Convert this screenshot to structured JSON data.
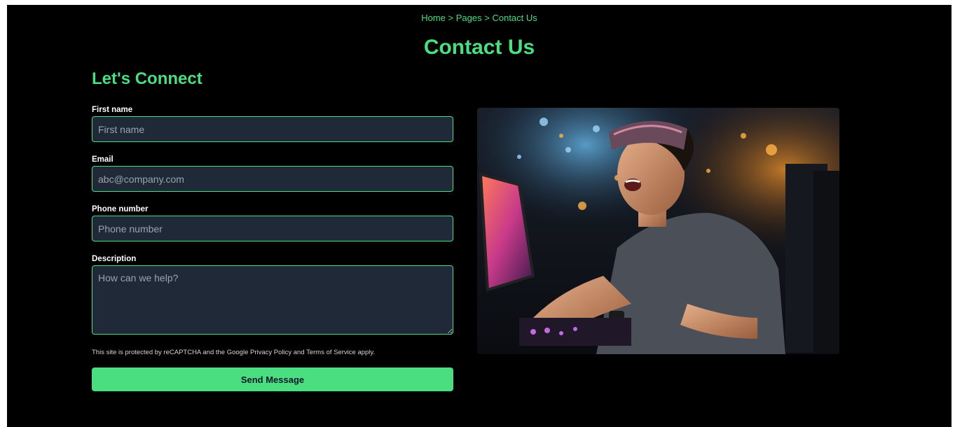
{
  "breadcrumb": {
    "home": "Home",
    "sep1": ">",
    "pages": "Pages",
    "sep2": ">",
    "current": "Contact Us"
  },
  "page_title": "Contact Us",
  "section_title": "Let's Connect",
  "form": {
    "first_name": {
      "label": "First name",
      "placeholder": "First name"
    },
    "email": {
      "label": "Email",
      "placeholder": "abc@company.com"
    },
    "phone": {
      "label": "Phone number",
      "placeholder": "Phone number"
    },
    "description": {
      "label": "Description",
      "placeholder": "How can we help?"
    },
    "recaptcha_note": "This site is protected by reCAPTCHA and the Google Privacy Policy and Terms of Service apply.",
    "submit_label": "Send Message"
  },
  "hero_image": {
    "alt": "gamer-photo"
  },
  "colors": {
    "accent": "#4ade80",
    "page_bg": "#000000",
    "input_bg": "#1f2937"
  }
}
